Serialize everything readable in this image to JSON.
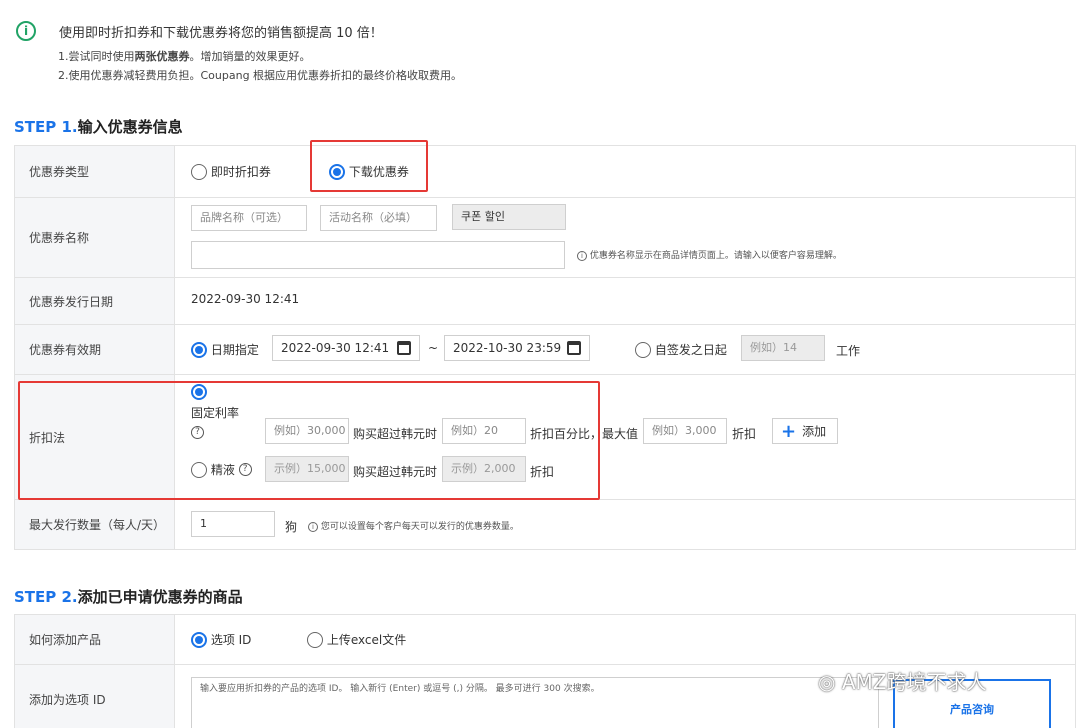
{
  "notice": {
    "title": "使用即时折扣券和下载优惠券将您的销售额提高 10 倍！",
    "line1_prefix": "1.尝试同时使用",
    "line1_bold": "两张优惠券",
    "line1_suffix": "。增加销量的效果更好。",
    "line2": "2.使用优惠券减轻费用负担。Coupang 根据应用优惠券折扣的最终价格收取费用。"
  },
  "step1": {
    "prefix": "STEP 1.",
    "title": "输入优惠券信息",
    "rows": {
      "type": {
        "label": "优惠券类型",
        "option_instant": "即时折扣券",
        "option_download": "下载优惠券"
      },
      "name": {
        "label": "优惠券名称",
        "brand_placeholder": "品牌名称（可选）",
        "event_placeholder": "活动名称（必填）",
        "fixed_text": "쿠폰 할인",
        "hint": "优惠券名称显示在商品详情页面上。请输入以便客户容易理解。"
      },
      "issue_date": {
        "label": "优惠券发行日期",
        "value": "2022-09-30 12:41"
      },
      "validity": {
        "label": "优惠券有效期",
        "option_date": "日期指定",
        "start": "2022-09-30 12:41",
        "tilde": "~",
        "end": "2022-10-30 23:59",
        "option_from_issue": "自签发之日起",
        "days_placeholder": "例如）14",
        "unit": "工作"
      },
      "discount": {
        "label": "折扣法",
        "fixed_rate": "固定利率",
        "amount_placeholder": "例如）30,000",
        "over_text": "购买超过韩元时",
        "percent_placeholder": "例如）20",
        "percent_text": "折扣百分比，最大值",
        "max_placeholder": "例如）3,000",
        "discount_word": "折扣",
        "add_button": "添加",
        "exact": "精液",
        "exact_amount_placeholder": "示例）15,000",
        "exact_over_text": "购买超过韩元时",
        "exact_value_placeholder": "示例）2,000",
        "exact_discount_word": "折扣"
      },
      "max_issue": {
        "label": "最大发行数量（每人/天）",
        "value": "1",
        "unit": "狗",
        "hint": "您可以设置每个客户每天可以发行的优惠券数量。"
      }
    }
  },
  "step2": {
    "prefix": "STEP 2.",
    "title": "添加已申请优惠券的商品",
    "rows": {
      "how": {
        "label": "如何添加产品",
        "option_id": "选项 ID",
        "option_excel": "上传excel文件"
      },
      "add_id": {
        "label": "添加为选项 ID",
        "placeholder": "输入要应用折扣券的产品的选项 ID。 输入新行 (Enter) 或逗号 (,) 分隔。 最多可进行 300 次搜索。",
        "query_button": "产品咨询"
      }
    }
  },
  "watermark": "AMZ跨境不求人",
  "colors": {
    "accent": "#1a73e8",
    "highlight": "#e53935",
    "info": "#21a366"
  }
}
